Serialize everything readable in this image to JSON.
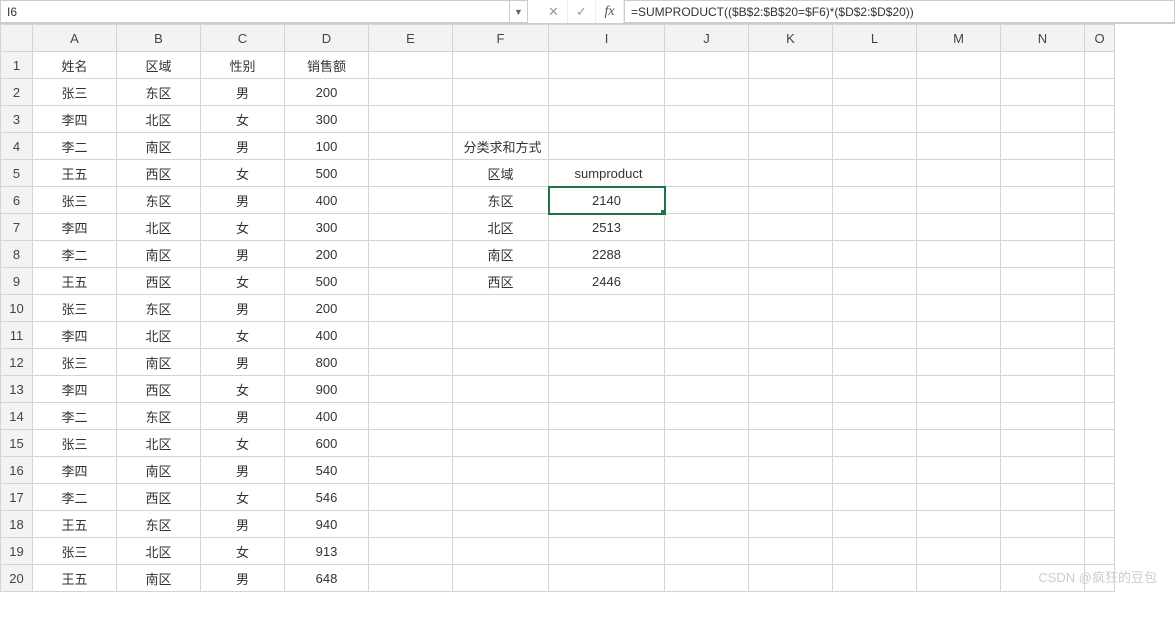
{
  "name_box": "I6",
  "formula": "=SUMPRODUCT(($B$2:$B$20=$F6)*($D$2:$D$20))",
  "selected": {
    "row": 6,
    "col": "I"
  },
  "columns": [
    "A",
    "B",
    "C",
    "D",
    "E",
    "F",
    "I",
    "J",
    "K",
    "L",
    "M",
    "N",
    "O"
  ],
  "rows": 20,
  "headers": {
    "A": "姓名",
    "B": "区域",
    "C": "性别",
    "D": "销售额"
  },
  "data_rows": [
    {
      "A": "张三",
      "B": "东区",
      "C": "男",
      "D": "200"
    },
    {
      "A": "李四",
      "B": "北区",
      "C": "女",
      "D": "300"
    },
    {
      "A": "李二",
      "B": "南区",
      "C": "男",
      "D": "100"
    },
    {
      "A": "王五",
      "B": "西区",
      "C": "女",
      "D": "500"
    },
    {
      "A": "张三",
      "B": "东区",
      "C": "男",
      "D": "400"
    },
    {
      "A": "李四",
      "B": "北区",
      "C": "女",
      "D": "300"
    },
    {
      "A": "李二",
      "B": "南区",
      "C": "男",
      "D": "200"
    },
    {
      "A": "王五",
      "B": "西区",
      "C": "女",
      "D": "500"
    },
    {
      "A": "张三",
      "B": "东区",
      "C": "男",
      "D": "200"
    },
    {
      "A": "李四",
      "B": "北区",
      "C": "女",
      "D": "400"
    },
    {
      "A": "张三",
      "B": "南区",
      "C": "男",
      "D": "800"
    },
    {
      "A": "李四",
      "B": "西区",
      "C": "女",
      "D": "900"
    },
    {
      "A": "李二",
      "B": "东区",
      "C": "男",
      "D": "400"
    },
    {
      "A": "张三",
      "B": "北区",
      "C": "女",
      "D": "600"
    },
    {
      "A": "李四",
      "B": "南区",
      "C": "男",
      "D": "540"
    },
    {
      "A": "李二",
      "B": "西区",
      "C": "女",
      "D": "546"
    },
    {
      "A": "王五",
      "B": "东区",
      "C": "男",
      "D": "940"
    },
    {
      "A": "张三",
      "B": "北区",
      "C": "女",
      "D": "913"
    },
    {
      "A": "王五",
      "B": "南区",
      "C": "男",
      "D": "648"
    }
  ],
  "overlay": {
    "F4": {
      "text": "分类求和方式",
      "align": "left"
    },
    "F5": {
      "text": "区域"
    },
    "I5": {
      "text": "sumproduct",
      "align": "left"
    },
    "F6": {
      "text": "东区"
    },
    "I6": {
      "text": "2140"
    },
    "F7": {
      "text": "北区"
    },
    "I7": {
      "text": "2513"
    },
    "F8": {
      "text": "南区"
    },
    "I8": {
      "text": "2288"
    },
    "F9": {
      "text": "西区"
    },
    "I9": {
      "text": "2446"
    }
  },
  "watermark": "CSDN @疯狂的豆包"
}
